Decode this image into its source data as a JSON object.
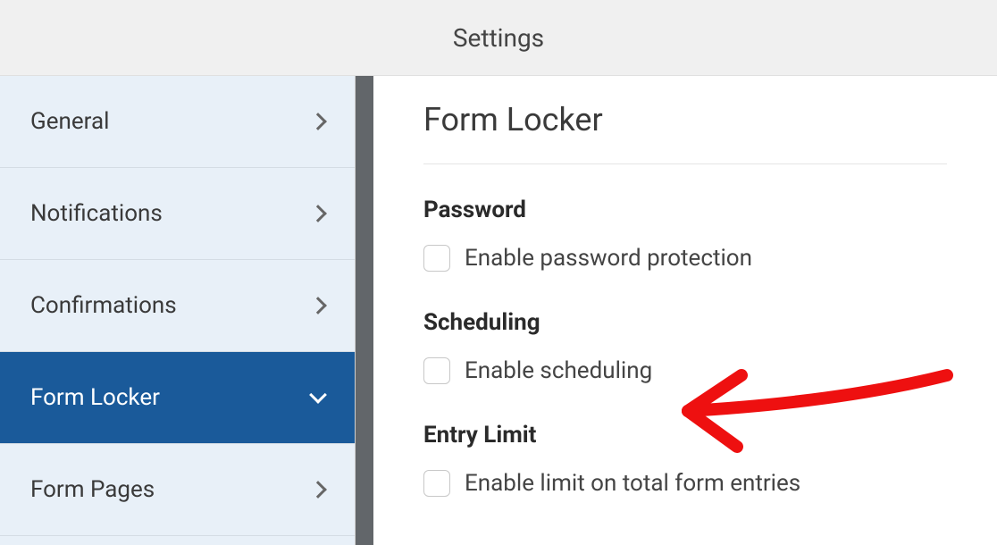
{
  "header": {
    "title": "Settings"
  },
  "sidebar": {
    "items": [
      {
        "label": "General",
        "active": false
      },
      {
        "label": "Notifications",
        "active": false
      },
      {
        "label": "Confirmations",
        "active": false
      },
      {
        "label": "Form Locker",
        "active": true
      },
      {
        "label": "Form Pages",
        "active": false
      }
    ]
  },
  "main": {
    "title": "Form Locker",
    "sections": {
      "password": {
        "heading": "Password",
        "checkbox_label": "Enable password protection"
      },
      "scheduling": {
        "heading": "Scheduling",
        "checkbox_label": "Enable scheduling"
      },
      "entry_limit": {
        "heading": "Entry Limit",
        "checkbox_label": "Enable limit on total form entries"
      }
    }
  }
}
